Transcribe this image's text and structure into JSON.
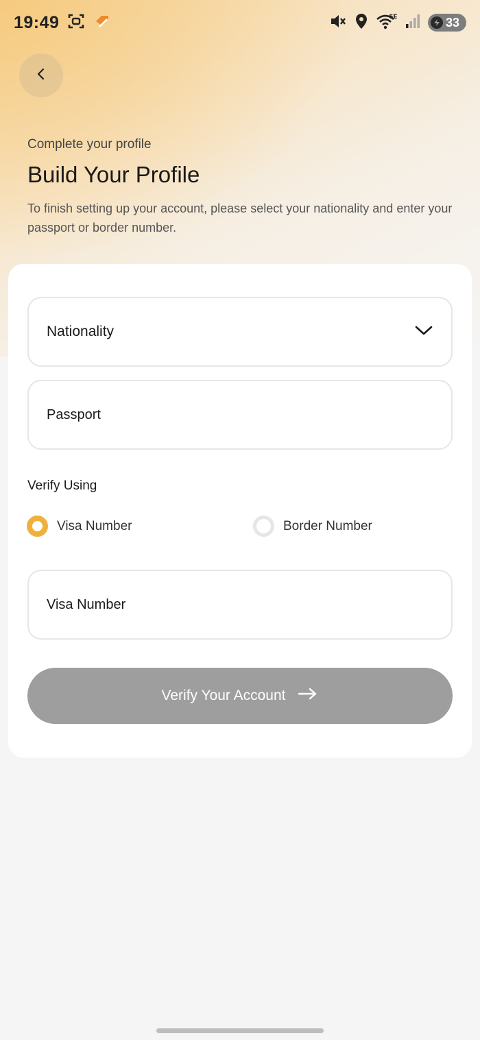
{
  "status_bar": {
    "time": "19:49",
    "battery": "33",
    "icons": [
      "screenshot-icon",
      "app-notification-icon",
      "mute-icon",
      "location-icon",
      "wifi-6e-icon",
      "cellular-signal-icon",
      "battery-icon"
    ],
    "wifi_label": "6E"
  },
  "header": {
    "back_icon": "chevron-left-icon",
    "eyebrow": "Complete your profile",
    "title": "Build Your Profile",
    "description": "To finish setting up your account, please select your nationality and enter your passport or border number."
  },
  "form": {
    "nationality": {
      "value": "Nationality",
      "icon": "chevron-down-icon"
    },
    "passport": {
      "placeholder": "Passport"
    },
    "verify_label": "Verify Using",
    "options": [
      {
        "label": "Visa Number",
        "selected": true
      },
      {
        "label": "Border Number",
        "selected": false
      }
    ],
    "visa": {
      "placeholder": "Visa Number"
    },
    "submit": {
      "label": "Verify Your Account",
      "icon": "arrow-right-icon"
    }
  },
  "colors": {
    "accent": "#f0b13c",
    "button_disabled": "#9e9e9e",
    "background": "#f5f5f5",
    "card": "#ffffff"
  }
}
